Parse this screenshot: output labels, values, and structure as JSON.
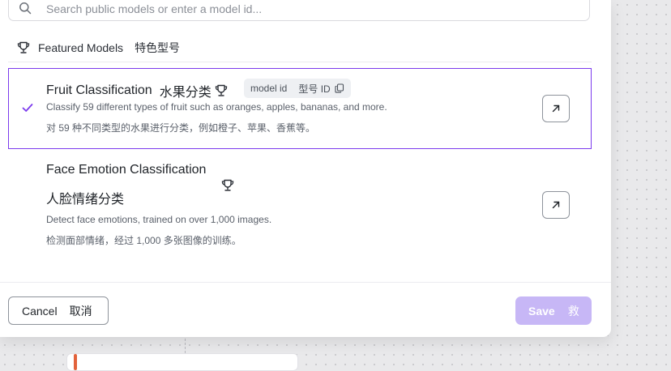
{
  "search": {
    "placeholder": "Search public models or enter a model id..."
  },
  "section": {
    "label": "Featured Models",
    "label_cn": "特色型号"
  },
  "models": [
    {
      "title": "Fruit Classification",
      "title_cn": "水果分类",
      "selected": true,
      "chip_label": "model id",
      "chip_label_cn": "型号 ID",
      "description": "Classify 59 different types of fruit such as oranges, apples, bananas, and more.",
      "description_cn": "对 59 种不同类型的水果进行分类，例如橙子、苹果、香蕉等。"
    },
    {
      "title": "Face Emotion Classification",
      "title_cn": "人脸情绪分类",
      "selected": false,
      "description": "Detect face emotions, trained on over 1,000 images.",
      "description_cn": "检测面部情绪，经过 1,000 多张图像的训练。"
    }
  ],
  "footer": {
    "cancel_label": "Cancel",
    "cancel_label_cn": "取消",
    "save_label": "Save",
    "save_label_cn": "救"
  },
  "icons": {
    "search": "search-icon",
    "trophy": "trophy-icon",
    "check": "check-icon",
    "copy": "copy-icon",
    "open": "arrow-up-right-icon"
  },
  "colors": {
    "accent": "#7c3aed",
    "save_disabled": "#c7b7f6",
    "border": "#8e939b"
  }
}
